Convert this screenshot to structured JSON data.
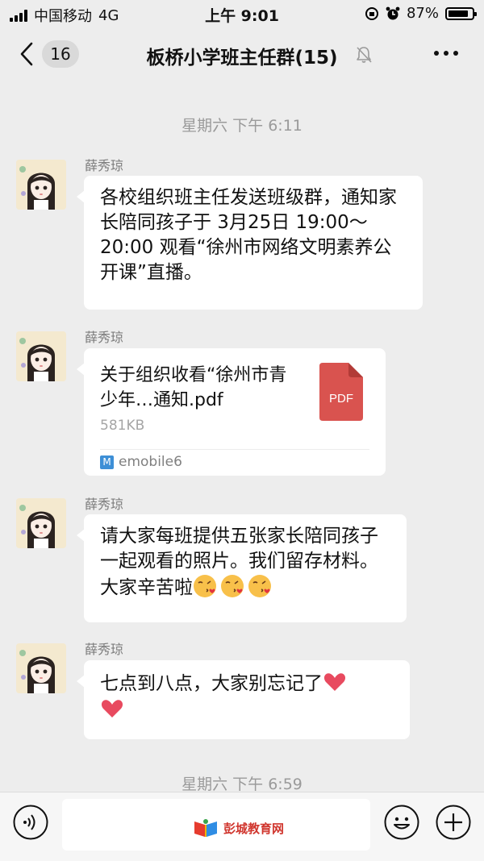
{
  "status_bar": {
    "carrier": "中国移动",
    "network": "4G",
    "time": "上午 9:01",
    "battery_percent": "87%",
    "battery_level": 0.87
  },
  "nav": {
    "unread_count": "16",
    "title": "板桥小学班主任群(15)"
  },
  "timestamps": {
    "first": "星期六 下午 6:11",
    "second": "星期六 下午 6:59"
  },
  "messages": [
    {
      "sender": "薛秀琼",
      "text": "各校组织班主任发送班级群，通知家长陪同孩子于 3月25日 19:00～20:00 观看“徐州市网络文明素养公开课”直播。"
    },
    {
      "sender": "薛秀琼",
      "file_name": "关于组织收看“徐州市青少年…通知.pdf",
      "file_size": "581KB",
      "file_type_label": "PDF",
      "source_app": "emobile6"
    },
    {
      "sender": "薛秀琼",
      "text": "请大家每班提供五张家长陪同孩子一起观看的照片。我们留存材料。大家辛苦啦",
      "emoji": [
        "kiss-emoji",
        "kiss-emoji",
        "kiss-emoji"
      ]
    },
    {
      "sender": "薛秀琼",
      "text": "七点到八点，大家别忘记了",
      "emoji": [
        "heart-emoji",
        "heart-emoji"
      ]
    }
  ],
  "input_bar": {
    "watermark_text": "彭城教育网"
  },
  "colors": {
    "background": "#ededed",
    "bubble": "#ffffff",
    "pdf_red": "#d9534f",
    "timestamp_gray": "#9a9a9a",
    "heart": "#e84a5f"
  }
}
